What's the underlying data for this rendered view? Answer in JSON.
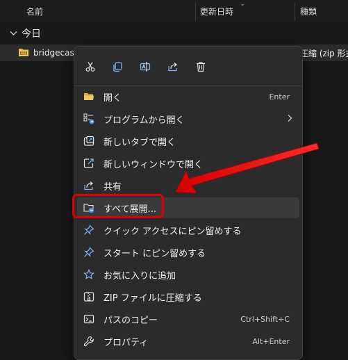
{
  "header": {
    "col_name": "名前",
    "col_date": "更新日時",
    "col_type": "種類"
  },
  "group": {
    "label": "今日"
  },
  "file": {
    "name": "bridgecast_",
    "type": "圧縮 (zip 形式"
  },
  "toolbar": [
    "cut-icon",
    "copy-icon",
    "rename-icon",
    "share-icon",
    "delete-icon"
  ],
  "menu": {
    "items": [
      {
        "label": "開く",
        "shortcut": "Enter",
        "icon": "folder-open-icon"
      },
      {
        "label": "プログラムから開く",
        "shortcut": "",
        "icon": "open-with-icon",
        "submenu": true
      },
      {
        "label": "新しいタブで開く",
        "shortcut": "",
        "icon": "new-tab-icon"
      },
      {
        "label": "新しいウィンドウで開く",
        "shortcut": "",
        "icon": "new-window-icon"
      },
      {
        "label": "共有",
        "shortcut": "",
        "icon": "share-icon"
      },
      {
        "label": "すべて展開...",
        "shortcut": "",
        "icon": "extract-all-icon",
        "highlighted": true
      },
      {
        "label": "クイック アクセスにピン留めする",
        "shortcut": "",
        "icon": "pin-icon"
      },
      {
        "label": "スタート にピン留めする",
        "shortcut": "",
        "icon": "pin-start-icon"
      },
      {
        "label": "お気に入りに追加",
        "shortcut": "",
        "icon": "star-icon"
      },
      {
        "label": "ZIP ファイルに圧縮する",
        "shortcut": "",
        "icon": "zip-icon"
      },
      {
        "label": "パスのコピー",
        "shortcut": "Ctrl+Shift+C",
        "icon": "copy-path-icon"
      },
      {
        "label": "プロパティ",
        "shortcut": "Alt+Enter",
        "icon": "properties-icon"
      }
    ]
  },
  "colors": {
    "accent": "#5aa0e6",
    "annotation": "#e00000",
    "background": "#191919",
    "menu": "#2b2b2b"
  }
}
